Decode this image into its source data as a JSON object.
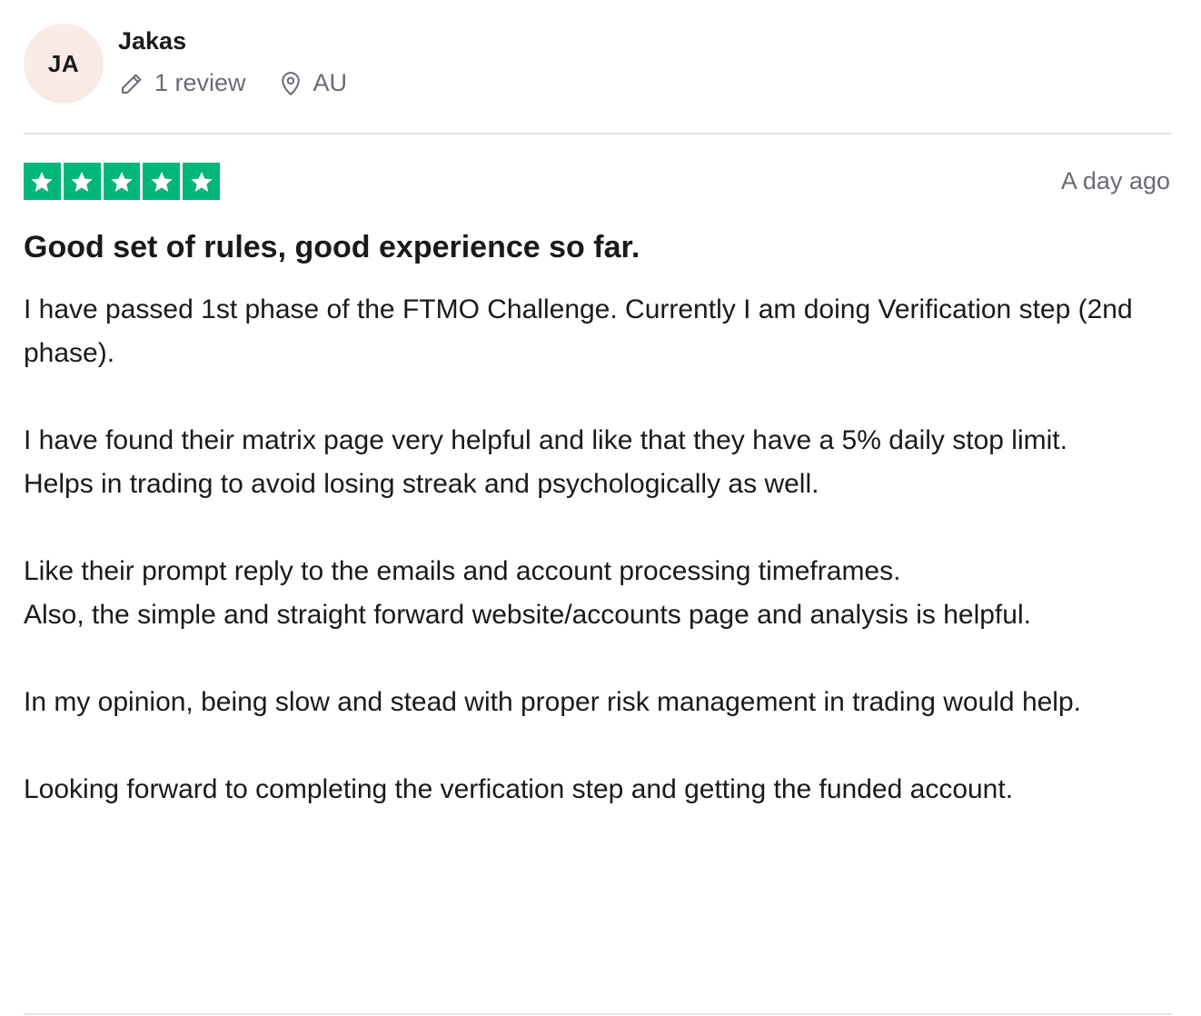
{
  "consumer": {
    "initials": "JA",
    "name": "Jakas",
    "review_count": "1 review",
    "country": "AU"
  },
  "review": {
    "rating": 5,
    "date": "A day ago",
    "title": "Good set of rules, good experience so far.",
    "paragraphs": {
      "p1": "I have passed 1st phase of the FTMO Challenge. Currently I am doing Verification step (2nd phase).",
      "p2a": "I have found their matrix page very helpful and like that they have a 5% daily stop limit.",
      "p2b": "Helps in trading to avoid losing streak and psychologically as well.",
      "p3a": "Like their prompt reply to the emails and account processing timeframes.",
      "p3b": "Also, the simple and straight forward website/accounts page and analysis is helpful.",
      "p4": "In my opinion, being slow and stead with proper risk management in trading would help.",
      "p5": "Looking forward to completing the verfication step and getting the funded account."
    }
  },
  "colors": {
    "star_green": "#00b67a",
    "avatar_bg": "#f9ebe3",
    "muted_text": "#6b6b76",
    "divider": "#e5e5dd"
  },
  "icons": {
    "review_count": "pencil-icon",
    "country": "location-pin-icon",
    "star": "star-icon"
  }
}
